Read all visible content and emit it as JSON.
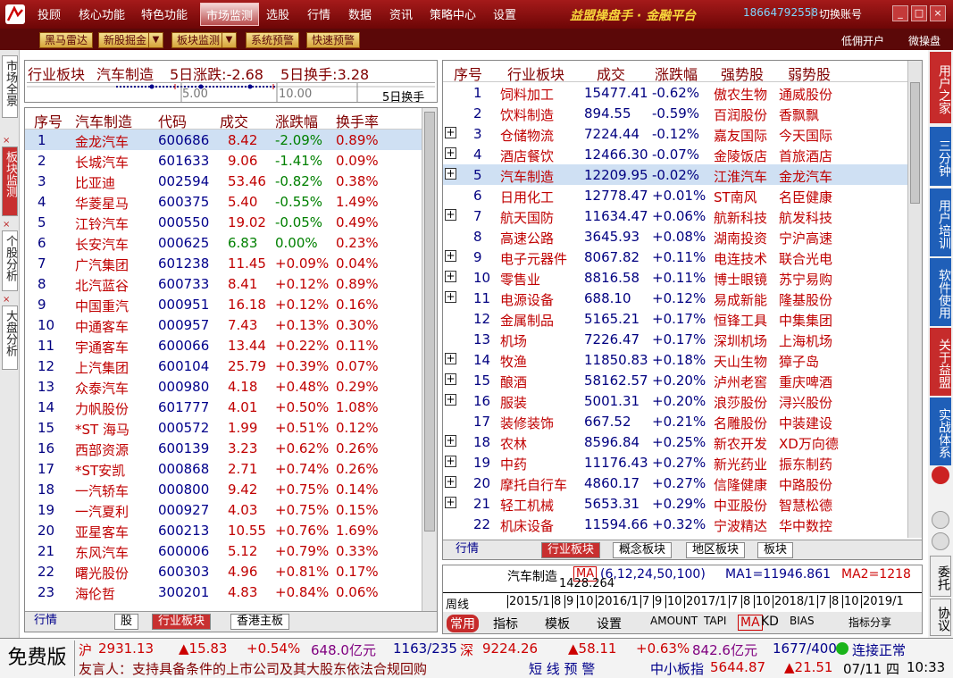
{
  "menu": {
    "items": [
      "投顾",
      "核心功能",
      "特色功能",
      "市场监测",
      "选股",
      "行情",
      "数据",
      "资讯",
      "策略中心",
      "设置"
    ],
    "brand": "益盟操盘手 · 金融平台",
    "phone": "18664792558",
    "divider": "|",
    "switch_account": "切换账号",
    "window_buttons": [
      "_",
      "□",
      "×"
    ]
  },
  "toolbar": {
    "buttons": [
      {
        "label": "黑马雷达",
        "dropdown": false
      },
      {
        "label": "新股掘金",
        "dropdown": true
      },
      {
        "label": "板块监测",
        "dropdown": true
      },
      {
        "label": "系统预警",
        "dropdown": false
      },
      {
        "label": "快速预警",
        "dropdown": false
      }
    ],
    "dropdown_glyph": "▼",
    "links": [
      "低佣开户",
      "微操盘"
    ]
  },
  "left_tabs": [
    {
      "label": "市场全景",
      "active": false
    },
    {
      "label": "板块监测",
      "active": true
    },
    {
      "label": "个股分析",
      "active": false
    },
    {
      "label": "大盘分析",
      "active": false
    }
  ],
  "left_close_glyph": "×",
  "summary": {
    "label": "行业板块",
    "sector": "汽车制造",
    "chg_text": "5日涨跌:-2.68",
    "turnover_text": "5日换手:3.28",
    "axis_ticks": [
      "5.00",
      "10.00"
    ],
    "axis_label": "5日换手"
  },
  "stock_table": {
    "headers": [
      "序号",
      "汽车制造",
      "代码",
      "成交",
      "涨跌幅",
      "换手率"
    ],
    "rows": [
      [
        "1",
        "金龙汽车",
        "600686",
        "8.42",
        "-2.09%",
        "0.89%"
      ],
      [
        "2",
        "长城汽车",
        "601633",
        "9.06",
        "-1.41%",
        "0.09%"
      ],
      [
        "3",
        "比亚迪",
        "002594",
        "53.46",
        "-0.82%",
        "0.38%"
      ],
      [
        "4",
        "华菱星马",
        "600375",
        "5.40",
        "-0.55%",
        "1.49%"
      ],
      [
        "5",
        "江铃汽车",
        "000550",
        "19.02",
        "-0.05%",
        "0.49%"
      ],
      [
        "6",
        "长安汽车",
        "000625",
        "6.83",
        "0.00%",
        "0.23%"
      ],
      [
        "7",
        "广汽集团",
        "601238",
        "11.45",
        "+0.09%",
        "0.04%"
      ],
      [
        "8",
        "北汽蓝谷",
        "600733",
        "8.41",
        "+0.12%",
        "0.89%"
      ],
      [
        "9",
        "中国重汽",
        "000951",
        "16.18",
        "+0.12%",
        "0.16%"
      ],
      [
        "10",
        "中通客车",
        "000957",
        "7.43",
        "+0.13%",
        "0.30%"
      ],
      [
        "11",
        "宇通客车",
        "600066",
        "13.44",
        "+0.22%",
        "0.11%"
      ],
      [
        "12",
        "上汽集团",
        "600104",
        "25.79",
        "+0.39%",
        "0.07%"
      ],
      [
        "13",
        "众泰汽车",
        "000980",
        "4.18",
        "+0.48%",
        "0.29%"
      ],
      [
        "14",
        "力帆股份",
        "601777",
        "4.01",
        "+0.50%",
        "1.08%"
      ],
      [
        "15",
        "*ST 海马",
        "000572",
        "1.99",
        "+0.51%",
        "0.12%"
      ],
      [
        "16",
        "西部资源",
        "600139",
        "3.23",
        "+0.62%",
        "0.26%"
      ],
      [
        "17",
        "*ST安凯",
        "000868",
        "2.71",
        "+0.74%",
        "0.26%"
      ],
      [
        "18",
        "一汽轿车",
        "000800",
        "9.42",
        "+0.75%",
        "0.14%"
      ],
      [
        "19",
        "一汽夏利",
        "000927",
        "4.03",
        "+0.75%",
        "0.15%"
      ],
      [
        "20",
        "亚星客车",
        "600213",
        "10.55",
        "+0.76%",
        "1.69%"
      ],
      [
        "21",
        "东风汽车",
        "600006",
        "5.12",
        "+0.79%",
        "0.33%"
      ],
      [
        "22",
        "曙光股份",
        "600303",
        "4.96",
        "+0.81%",
        "0.17%"
      ],
      [
        "23",
        "海伦哲",
        "300201",
        "4.83",
        "+0.84%",
        "0.06%"
      ]
    ]
  },
  "left_bottom_tabs": [
    "行情",
    "股",
    "行业板块",
    "香港主板"
  ],
  "sector_table": {
    "headers": [
      "序号",
      "行业板块",
      "成交",
      "涨跌幅",
      "强势股",
      "弱势股"
    ],
    "rows": [
      {
        "no": "1",
        "name": "饲料加工",
        "vol": "15477.41",
        "chg": "-0.62%",
        "strong": "傲农生物",
        "weak": "通威股份",
        "plus": false
      },
      {
        "no": "2",
        "name": "饮料制造",
        "vol": "894.55",
        "chg": "-0.59%",
        "strong": "百润股份",
        "weak": "香飘飘",
        "plus": false
      },
      {
        "no": "3",
        "name": "仓储物流",
        "vol": "7224.44",
        "chg": "-0.12%",
        "strong": "嘉友国际",
        "weak": "今天国际",
        "plus": true
      },
      {
        "no": "4",
        "name": "酒店餐饮",
        "vol": "12466.30",
        "chg": "-0.07%",
        "strong": "金陵饭店",
        "weak": "首旅酒店",
        "plus": true
      },
      {
        "no": "5",
        "name": "汽车制造",
        "vol": "12209.95",
        "chg": "-0.02%",
        "strong": "江淮汽车",
        "weak": "金龙汽车",
        "plus": true
      },
      {
        "no": "6",
        "name": "日用化工",
        "vol": "12778.47",
        "chg": "+0.01%",
        "strong": "ST南风",
        "weak": "名臣健康",
        "plus": false
      },
      {
        "no": "7",
        "name": "航天国防",
        "vol": "11634.47",
        "chg": "+0.06%",
        "strong": "航新科技",
        "weak": "航发科技",
        "plus": true
      },
      {
        "no": "8",
        "name": "高速公路",
        "vol": "3645.93",
        "chg": "+0.08%",
        "strong": "湖南投资",
        "weak": "宁沪高速",
        "plus": false
      },
      {
        "no": "9",
        "name": "电子元器件",
        "vol": "8067.82",
        "chg": "+0.11%",
        "strong": "电连技术",
        "weak": "联合光电",
        "plus": true
      },
      {
        "no": "10",
        "name": "零售业",
        "vol": "8816.58",
        "chg": "+0.11%",
        "strong": "博士眼镜",
        "weak": "苏宁易购",
        "plus": true
      },
      {
        "no": "11",
        "name": "电源设备",
        "vol": "688.10",
        "chg": "+0.12%",
        "strong": "易成新能",
        "weak": "隆基股份",
        "plus": true
      },
      {
        "no": "12",
        "name": "金属制品",
        "vol": "5165.21",
        "chg": "+0.17%",
        "strong": "恒锋工具",
        "weak": "中集集团",
        "plus": false
      },
      {
        "no": "13",
        "name": "机场",
        "vol": "7226.47",
        "chg": "+0.17%",
        "strong": "深圳机场",
        "weak": "上海机场",
        "plus": false
      },
      {
        "no": "14",
        "name": "牧渔",
        "vol": "11850.83",
        "chg": "+0.18%",
        "strong": "天山生物",
        "weak": "獐子岛",
        "plus": true
      },
      {
        "no": "15",
        "name": "酿酒",
        "vol": "58162.57",
        "chg": "+0.20%",
        "strong": "泸州老窖",
        "weak": "重庆啤酒",
        "plus": true
      },
      {
        "no": "16",
        "name": "服装",
        "vol": "5001.31",
        "chg": "+0.20%",
        "strong": "浪莎股份",
        "weak": "浔兴股份",
        "plus": true
      },
      {
        "no": "17",
        "name": "装修装饰",
        "vol": "667.52",
        "chg": "+0.21%",
        "strong": "名雕股份",
        "weak": "中装建设",
        "plus": false
      },
      {
        "no": "18",
        "name": "农林",
        "vol": "8596.84",
        "chg": "+0.25%",
        "strong": "新农开发",
        "weak": "XD万向德",
        "plus": true
      },
      {
        "no": "19",
        "name": "中药",
        "vol": "11176.43",
        "chg": "+0.27%",
        "strong": "新光药业",
        "weak": "振东制药",
        "plus": true
      },
      {
        "no": "20",
        "name": "摩托自行车",
        "vol": "4860.17",
        "chg": "+0.27%",
        "strong": "信隆健康",
        "weak": "中路股份",
        "plus": true
      },
      {
        "no": "21",
        "name": "轻工机械",
        "vol": "5653.31",
        "chg": "+0.29%",
        "strong": "中亚股份",
        "weak": "智慧松德",
        "plus": true
      },
      {
        "no": "22",
        "name": "机床设备",
        "vol": "11594.66",
        "chg": "+0.32%",
        "strong": "宁波精达",
        "weak": "华中数控",
        "plus": false
      }
    ]
  },
  "right_bottom_tabs": [
    "行情",
    "行业板块",
    "概念板块",
    "地区板块",
    "板块"
  ],
  "chart_strip": {
    "name": "汽车制造",
    "ma_label": "MA",
    "ma_params": "(6,12,24,50,100)",
    "ma1": "MA1=11946.861",
    "ma2": "MA2=1218",
    "overlap_text": "1428.264",
    "period": "周线",
    "dates": [
      "2015/1",
      "8",
      "9",
      "10",
      "2016/1",
      "7",
      "9",
      "10",
      "2017/1",
      "7",
      "8",
      "10",
      "2018/1",
      "7",
      "8",
      "10",
      "2019/1"
    ],
    "tools": [
      "常用",
      "指标",
      "模板",
      "设置",
      "AMOUNT",
      "TAPI",
      "MA",
      "KD",
      "BIAS",
      "指标分享"
    ]
  },
  "right_strip": [
    {
      "label": "用户之家",
      "style": "red"
    },
    {
      "label": "三分钟",
      "style": "blue"
    },
    {
      "label": "用户培训",
      "style": "blue"
    },
    {
      "label": "软件使用",
      "style": "blue"
    },
    {
      "label": "关于益盟",
      "style": "red"
    },
    {
      "label": "实战体系",
      "style": "blue"
    },
    {
      "label": "委托",
      "style": "gray"
    },
    {
      "label": "协议",
      "style": "gray"
    }
  ],
  "status": {
    "free": "免费版",
    "sh_label": "沪",
    "sh_value": "2931.13",
    "sh_change": "▲15.83",
    "sh_pct": "+0.54%",
    "sh_amount": "648.0亿元",
    "sh_count": "1163/235",
    "sz_label": "深",
    "sz_value": "9224.26",
    "sz_change": "▲58.11",
    "sz_pct": "+0.63%",
    "sz_amount": "842.6亿元",
    "sz_count": "1677/400",
    "connection": "连接正常",
    "ticker": "友言人：支持具备条件的上市公司及其大股东依法合规回购",
    "alert": "短 线 预 警",
    "sme_label": "中小板指",
    "sme_value": "5644.87",
    "sme_change": "▲21.51",
    "date": "07/11 四",
    "time": "10:33"
  },
  "colors": {
    "menu_bg": "#8b1010",
    "up": "#c00000",
    "down": "#008000",
    "code": "#00008b",
    "selected_row": "#cfe0f3"
  }
}
